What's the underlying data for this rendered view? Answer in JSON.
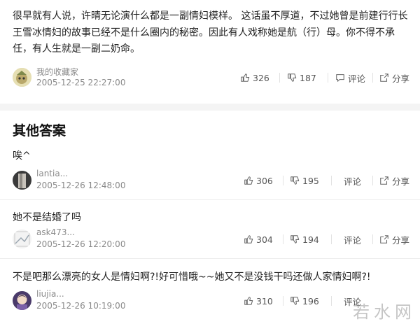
{
  "best_answer": {
    "text": "很早就有人说，许晴无论演什么都是一副情妇模样。 这话虽不厚道，不过她曾是前建行行长王雪冰情妇的故事已经不是什么圈内的秘密。因此有人戏称她是航（行）母。你不得不承任，有人生就是一副二奶命。",
    "user": "我的收藏家",
    "date": "2005-12-25 22:27:00",
    "likes": "326",
    "dislikes": "187",
    "comment_label": "评论",
    "share_label": "分享"
  },
  "other_answers": {
    "title": "其他答案",
    "items": [
      {
        "text": "唉^",
        "user": "lantia...",
        "date": "2005-12-26 12:48:00",
        "likes": "306",
        "dislikes": "195",
        "comment_label": "评论",
        "share_label": "分享"
      },
      {
        "text": "她不是结婚了吗",
        "user": "ask473...",
        "date": "2005-12-26 12:20:00",
        "likes": "304",
        "dislikes": "194",
        "comment_label": "评论",
        "share_label": "分享"
      },
      {
        "text": "不是吧那么漂亮的女人是情妇啊?!好可惜哦~~她又不是没钱干吗还做人家情妇啊?!",
        "user": "liujia...",
        "date": "2005-12-26 10:19:00",
        "likes": "310",
        "dislikes": "196",
        "comment_label": "评论",
        "share_label": "分享"
      }
    ]
  },
  "watermark": "若水网"
}
